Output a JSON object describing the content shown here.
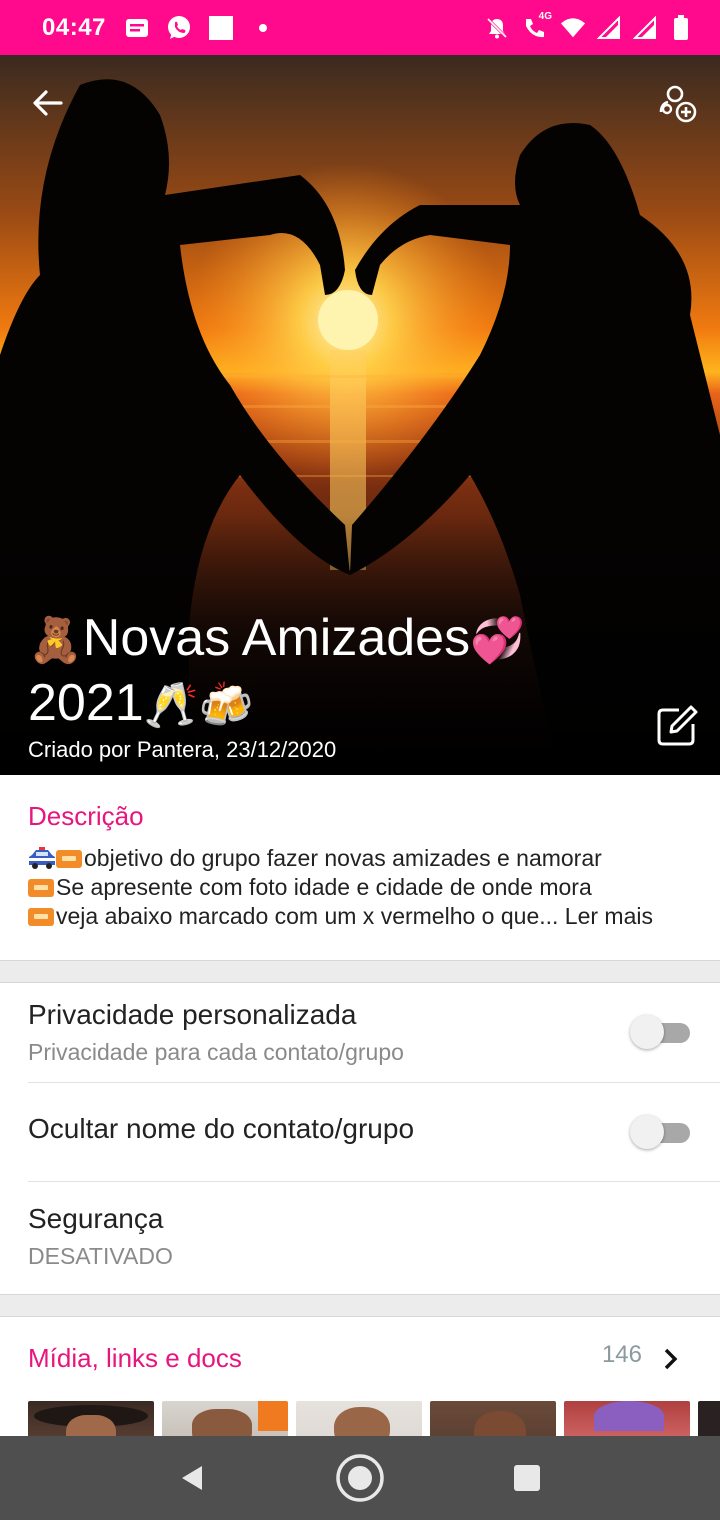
{
  "status_bar": {
    "time": "04:47",
    "left_icons": [
      "message-icon",
      "whatsapp-icon",
      "square-icon",
      "dot-icon"
    ],
    "network_label": "4G",
    "right_icons": [
      "mute-icon",
      "call-4g-icon",
      "wifi-icon",
      "signal-icon",
      "signal-icon",
      "battery-icon"
    ]
  },
  "header": {
    "title_line1": "Novas Amizades",
    "title_line2": "2021",
    "created_by": "Criado por Pantera, 23/12/2020",
    "emojis": {
      "teddy": "🧸",
      "hearts": "💞",
      "champagne": "🥂",
      "beer": "🍻"
    }
  },
  "description": {
    "title": "Descrição",
    "lines": [
      "objetivo do grupo fazer novas amizades e namorar",
      "Se apresente com foto idade e cidade de onde mora",
      "veja abaixo marcado com um x vermelho o que..."
    ],
    "more_label": "Ler mais"
  },
  "settings": {
    "privacy": {
      "title": "Privacidade personalizada",
      "subtitle": "Privacidade para cada contato/grupo",
      "enabled": false
    },
    "hide_name": {
      "title": "Ocultar nome do contato/grupo",
      "enabled": false
    },
    "security": {
      "title": "Segurança",
      "subtitle": "DESATIVADO"
    }
  },
  "media": {
    "title": "Mídia, links e docs",
    "count": "146"
  },
  "colors": {
    "accent": "#ff0a8c",
    "section_title": "#e8157f",
    "nav_bar": "#4f4f4f"
  }
}
